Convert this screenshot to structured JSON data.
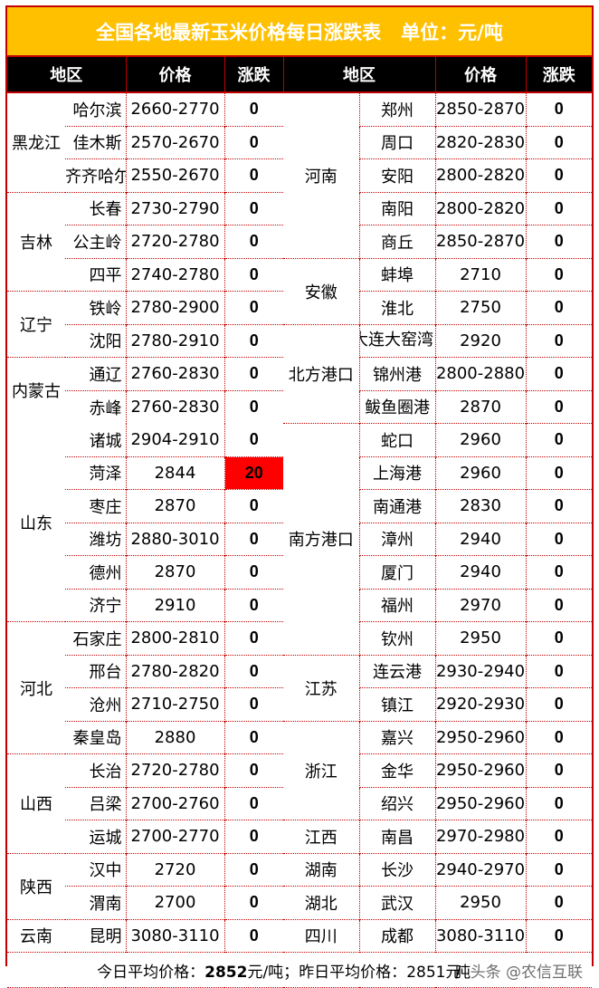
{
  "title": {
    "main": "全国各地最新玉米价格每日涨跌表",
    "unit": "单位：元/吨"
  },
  "colors": {
    "title_bg": "#ffc000",
    "header_bg": "#000000",
    "border": "#c00000",
    "increase_bg": "#ff0000"
  },
  "headers": [
    "地区",
    "价格",
    "涨跌",
    "地区",
    "价格",
    "涨跌"
  ],
  "left_groups": [
    {
      "province": "黑龙江",
      "rows": [
        {
          "city": "哈尔滨",
          "price": "2660-2770",
          "change": "0"
        },
        {
          "city": "佳木斯",
          "price": "2570-2670",
          "change": "0"
        },
        {
          "city": "齐齐哈尔",
          "price": "2550-2670",
          "change": "0"
        }
      ]
    },
    {
      "province": "吉林",
      "rows": [
        {
          "city": "长春",
          "price": "2730-2790",
          "change": "0"
        },
        {
          "city": "公主岭",
          "price": "2720-2780",
          "change": "0"
        },
        {
          "city": "四平",
          "price": "2740-2780",
          "change": "0"
        }
      ]
    },
    {
      "province": "辽宁",
      "rows": [
        {
          "city": "铁岭",
          "price": "2780-2900",
          "change": "0"
        },
        {
          "city": "沈阳",
          "price": "2780-2910",
          "change": "0"
        }
      ]
    },
    {
      "province": "内蒙古",
      "rows": [
        {
          "city": "通辽",
          "price": "2760-2830",
          "change": "0"
        },
        {
          "city": "赤峰",
          "price": "2760-2830",
          "change": "0"
        }
      ]
    },
    {
      "province": "山东",
      "rows": [
        {
          "city": "诸城",
          "price": "2904-2910",
          "change": "0"
        },
        {
          "city": "菏泽",
          "price": "2844",
          "change": "20",
          "highlight": true
        },
        {
          "city": "枣庄",
          "price": "2870",
          "change": "0"
        },
        {
          "city": "潍坊",
          "price": "2880-3010",
          "change": "0"
        },
        {
          "city": "德州",
          "price": "2870",
          "change": "0"
        },
        {
          "city": "济宁",
          "price": "2910",
          "change": "0"
        }
      ]
    },
    {
      "province": "河北",
      "rows": [
        {
          "city": "石家庄",
          "price": "2800-2810",
          "change": "0"
        },
        {
          "city": "邢台",
          "price": "2780-2820",
          "change": "0"
        },
        {
          "city": "沧州",
          "price": "2710-2750",
          "change": "0"
        },
        {
          "city": "秦皇岛",
          "price": "2880",
          "change": "0"
        }
      ]
    },
    {
      "province": "山西",
      "rows": [
        {
          "city": "长治",
          "price": "2720-2780",
          "change": "0"
        },
        {
          "city": "吕梁",
          "price": "2700-2760",
          "change": "0"
        },
        {
          "city": "运城",
          "price": "2700-2770",
          "change": "0"
        }
      ]
    },
    {
      "province": "陕西",
      "rows": [
        {
          "city": "汉中",
          "price": "2720",
          "change": "0"
        },
        {
          "city": "渭南",
          "price": "2700",
          "change": "0"
        }
      ]
    },
    {
      "province": "云南",
      "rows": [
        {
          "city": "昆明",
          "price": "3080-3110",
          "change": "0"
        }
      ]
    }
  ],
  "right_groups": [
    {
      "province": "河南",
      "rows": [
        {
          "city": "郑州",
          "price": "2850-2870",
          "change": "0"
        },
        {
          "city": "周口",
          "price": "2820-2830",
          "change": "0"
        },
        {
          "city": "安阳",
          "price": "2800-2820",
          "change": "0"
        },
        {
          "city": "南阳",
          "price": "2800-2820",
          "change": "0"
        },
        {
          "city": "商丘",
          "price": "2850-2870",
          "change": "0"
        }
      ]
    },
    {
      "province": "安徽",
      "rows": [
        {
          "city": "蚌埠",
          "price": "2710",
          "change": "0"
        },
        {
          "city": "淮北",
          "price": "2750",
          "change": "0"
        }
      ]
    },
    {
      "province": "北方港口",
      "rows": [
        {
          "city": "大连大窑湾港",
          "price": "2920",
          "change": "0",
          "clipped": true
        },
        {
          "city": "锦州港",
          "price": "2800-2880",
          "change": "0"
        },
        {
          "city": "鲅鱼圈港",
          "price": "2870",
          "change": "0"
        }
      ]
    },
    {
      "province": "南方港口",
      "rows": [
        {
          "city": "蛇口",
          "price": "2960",
          "change": "0"
        },
        {
          "city": "上海港",
          "price": "2960",
          "change": "0"
        },
        {
          "city": "南通港",
          "price": "2830",
          "change": "0"
        },
        {
          "city": "漳州",
          "price": "2940",
          "change": "0"
        },
        {
          "city": "厦门",
          "price": "2940",
          "change": "0"
        },
        {
          "city": "福州",
          "price": "2970",
          "change": "0"
        },
        {
          "city": "钦州",
          "price": "2950",
          "change": "0"
        }
      ]
    },
    {
      "province": "江苏",
      "rows": [
        {
          "city": "连云港",
          "price": "2930-2940",
          "change": "0"
        },
        {
          "city": "镇江",
          "price": "2920-2930",
          "change": "0"
        }
      ]
    },
    {
      "province": "浙江",
      "rows": [
        {
          "city": "嘉兴",
          "price": "2950-2960",
          "change": "0"
        },
        {
          "city": "金华",
          "price": "2950-2960",
          "change": "0"
        },
        {
          "city": "绍兴",
          "price": "2950-2960",
          "change": "0"
        }
      ]
    },
    {
      "province": "江西",
      "rows": [
        {
          "city": "南昌",
          "price": "2970-2980",
          "change": "0"
        }
      ]
    },
    {
      "province": "湖南",
      "rows": [
        {
          "city": "长沙",
          "price": "2940-2970",
          "change": "0"
        }
      ]
    },
    {
      "province": "湖北",
      "rows": [
        {
          "city": "武汉",
          "price": "2950",
          "change": "0"
        }
      ]
    },
    {
      "province": "四川",
      "rows": [
        {
          "city": "成都",
          "price": "3080-3110",
          "change": "0"
        }
      ]
    }
  ],
  "footer": {
    "today_label": "今日平均价格：",
    "today_value": "2852",
    "today_unit": "元/吨；",
    "yesterday_label": "昨日平均价格：",
    "yesterday_value": "2851",
    "yesterday_unit": "元/吨",
    "watermark": "头条 @农信互联"
  }
}
